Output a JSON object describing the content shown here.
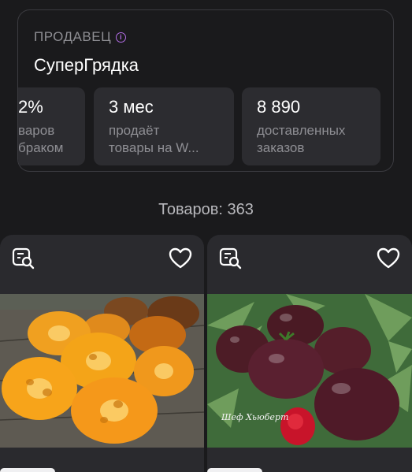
{
  "seller": {
    "label": "ПРОДАВЕЦ",
    "name": "СуперГрядка",
    "stats": [
      {
        "value": "2%",
        "line1": "варов",
        "line2": "браком"
      },
      {
        "value": "3 мес",
        "line1": "продаёт",
        "line2": "товары на W..."
      },
      {
        "value": "8 890",
        "line1": "доставленных",
        "line2": "заказов"
      }
    ]
  },
  "products_count": "Товаров: 363",
  "products": [
    {
      "image": "tomato-orange-slices-photo",
      "caption": ""
    },
    {
      "image": "tomato-dark-purple-photo",
      "caption": "Шеф Хьюберт"
    }
  ],
  "colors": {
    "background": "#1a1a1c",
    "card": "#2c2c30",
    "accent": "#b36ee6"
  }
}
